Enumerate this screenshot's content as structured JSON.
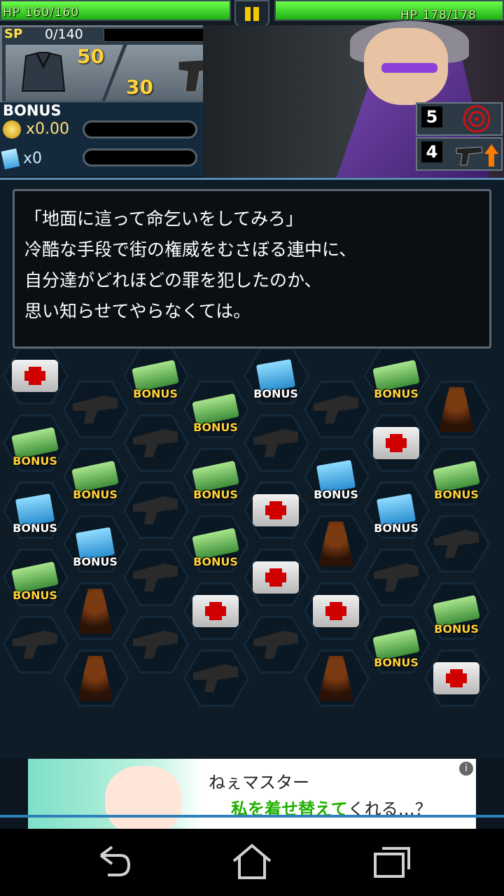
{
  "player": {
    "hp_text": "HP  160/160",
    "hp_fraction": 1.0
  },
  "enemy": {
    "hp_text": "HP  178/178",
    "hp_fraction": 1.0
  },
  "sp": {
    "label": "SP",
    "value": "0/140",
    "fill_fraction": 0
  },
  "weapons": {
    "armor_value": "50",
    "gun_value": "30"
  },
  "bonus": {
    "title": "BONUS",
    "coin_multiplier": "x0.00",
    "ticket_count": "x0"
  },
  "enemy_counters": [
    {
      "value": "5",
      "icon": "target-icon"
    },
    {
      "value": "4",
      "icon": "gun-up-icon"
    }
  ],
  "dialog": {
    "lines": [
      "「地面に這って命乞いをしてみろ」",
      "冷酷な手段で街の権威をむさぼる連中に、",
      "自分達がどれほどの罪を犯したのか、",
      "思い知らせてやらなくては。"
    ]
  },
  "tile_label": "BONUS",
  "board": [
    [
      "med",
      "gun",
      "cash",
      "cash",
      "card",
      "gun",
      "cash",
      "mob",
      "med"
    ],
    [
      "cash",
      "cash",
      "gun",
      "cash",
      "gun",
      "card",
      "med",
      "cash",
      "gun"
    ],
    [
      "card",
      "card",
      "gun",
      "cash",
      "med",
      "mob",
      "card",
      "gun",
      "cash"
    ],
    [
      "cash",
      "mob",
      "gun",
      "med",
      "med",
      "med",
      "gun",
      "cash",
      "card"
    ],
    [
      "gun",
      "mob",
      "gun",
      "gun",
      "gun",
      "mob",
      "cash",
      "med",
      "med"
    ]
  ],
  "ad": {
    "line1": "ねぇマスター",
    "line2_green": "私を着せ替えて",
    "line2_rest": "くれる…？",
    "info": "i"
  },
  "colors": {
    "hp_green": "#3fe02a",
    "sp_yellow": "#ffe24a",
    "accent_blue": "#2f7fb8"
  }
}
